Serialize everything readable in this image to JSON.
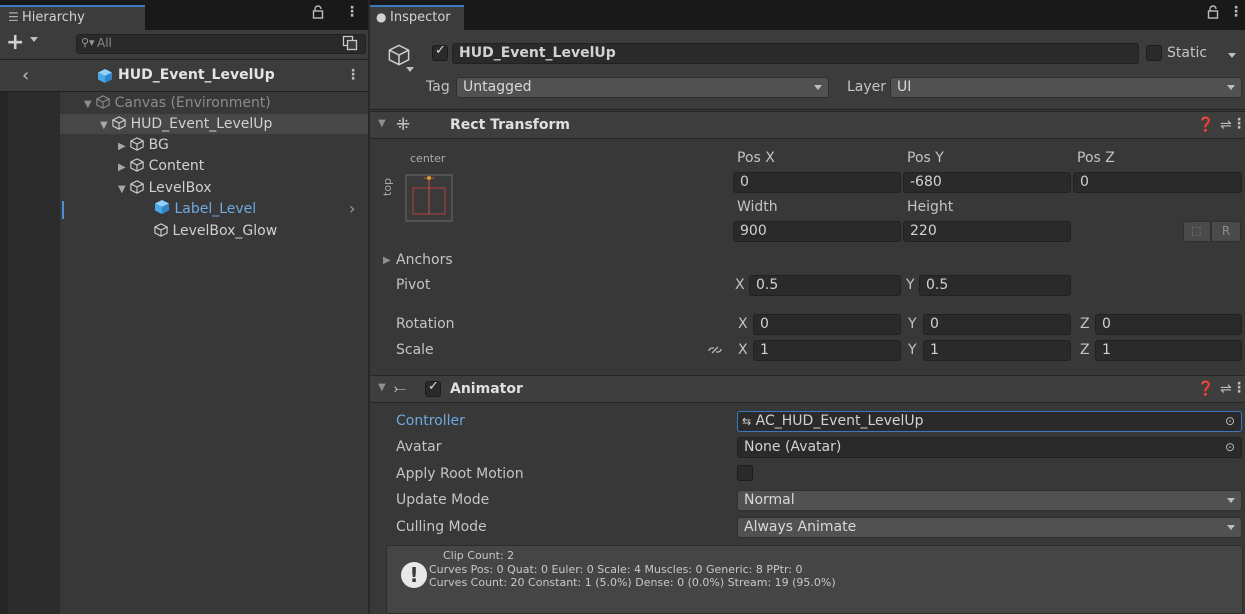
{
  "hierarchy": {
    "tab_label": "Hierarchy",
    "search_placeholder": "All",
    "prefab_title": "HUD_Event_LevelUp",
    "tree": [
      {
        "label": "Canvas (Environment)",
        "depth": 0,
        "expanded": true,
        "dim": true
      },
      {
        "label": "HUD_Event_LevelUp",
        "depth": 1,
        "expanded": true,
        "selected": true
      },
      {
        "label": "BG",
        "depth": 2,
        "expanded": false
      },
      {
        "label": "Content",
        "depth": 2,
        "expanded": false
      },
      {
        "label": "LevelBox",
        "depth": 2,
        "expanded": true
      },
      {
        "label": "Label_Level",
        "depth": 3,
        "prefab": true
      },
      {
        "label": "LevelBox_Glow",
        "depth": 3
      }
    ]
  },
  "inspector": {
    "tab_label": "Inspector",
    "object_name": "HUD_Event_LevelUp",
    "static_label": "Static",
    "tag_label": "Tag",
    "tag_value": "Untagged",
    "layer_label": "Layer",
    "layer_value": "UI"
  },
  "rect_transform": {
    "title": "Rect Transform",
    "anchor_h": "center",
    "anchor_v": "top",
    "pos_x_label": "Pos X",
    "pos_x": "0",
    "pos_y_label": "Pos Y",
    "pos_y": "-680",
    "pos_z_label": "Pos Z",
    "pos_z": "0",
    "width_label": "Width",
    "width": "900",
    "height_label": "Height",
    "height": "220",
    "r_button": "R",
    "anchors_label": "Anchors",
    "pivot_label": "Pivot",
    "pivot_x": "0.5",
    "pivot_y": "0.5",
    "rotation_label": "Rotation",
    "rot_x": "0",
    "rot_y": "0",
    "rot_z": "0",
    "scale_label": "Scale",
    "scale_x": "1",
    "scale_y": "1",
    "scale_z": "1",
    "axis_x": "X",
    "axis_y": "Y",
    "axis_z": "Z"
  },
  "animator": {
    "title": "Animator",
    "controller_label": "Controller",
    "controller_value": "AC_HUD_Event_LevelUp",
    "avatar_label": "Avatar",
    "avatar_value": "None (Avatar)",
    "apply_root_motion_label": "Apply Root Motion",
    "update_mode_label": "Update Mode",
    "update_mode_value": "Normal",
    "culling_mode_label": "Culling Mode",
    "culling_mode_value": "Always Animate",
    "info_line1": "Clip Count: 2",
    "info_line2": "Curves Pos: 0 Quat: 0 Euler: 0 Scale: 4 Muscles: 0 Generic: 8 PPtr: 0",
    "info_line3": "Curves Count: 20 Constant: 1 (5.0%) Dense: 0 (0.0%) Stream: 19 (95.0%)"
  },
  "colors": {
    "accent": "#3a79bb",
    "link_blue": "#6fa8e0",
    "prefab_blue": "#5fb3f0"
  }
}
